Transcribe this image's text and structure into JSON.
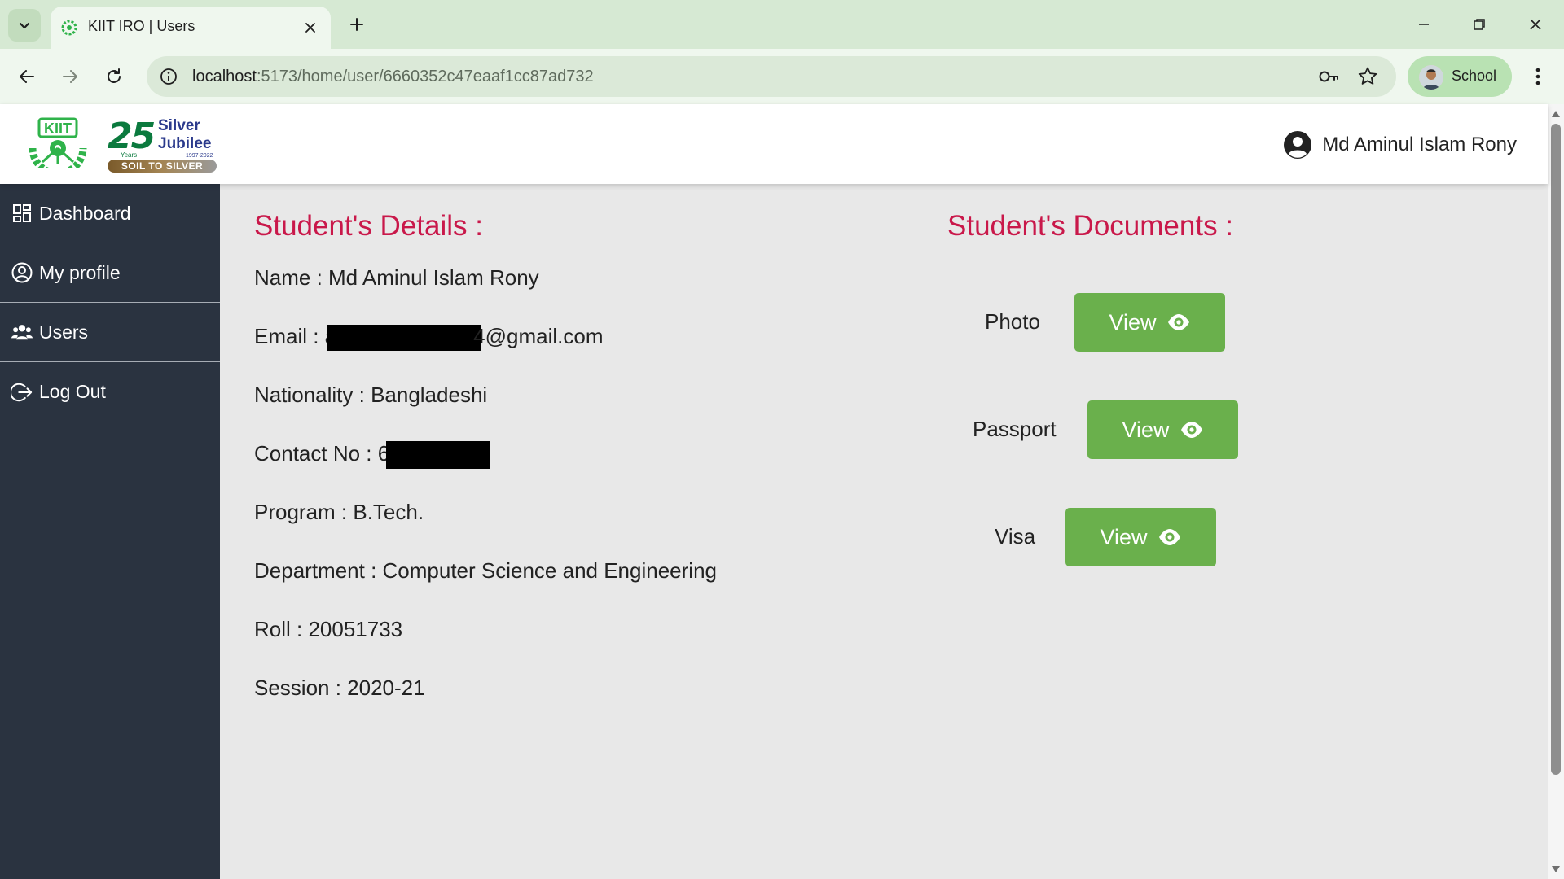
{
  "browser": {
    "tab_title": "KIIT IRO | Users",
    "url_host": "localhost",
    "url_rest": ":5173/home/user/6660352c47eaaf1cc87ad732",
    "profile_label": "School"
  },
  "header": {
    "jubilee_number": "25",
    "jubilee_years": "Years",
    "jubilee_line1": "Silver",
    "jubilee_line2": "Jubilee",
    "jubilee_range": "1997-2022",
    "jubilee_banner": "SOIL TO SILVER",
    "user_name": "Md Aminul Islam Rony"
  },
  "sidebar": {
    "items": [
      {
        "label": "Dashboard",
        "icon": "dashboard-icon"
      },
      {
        "label": "My profile",
        "icon": "user-circle-icon"
      },
      {
        "label": "Users",
        "icon": "users-icon"
      },
      {
        "label": "Log Out",
        "icon": "logout-icon"
      }
    ]
  },
  "details": {
    "title": "Student's Details :",
    "name": "Name : Md Aminul Islam Rony",
    "email_prefix": "Email : a",
    "email_suffix": "4@gmail.com",
    "nationality": "Nationality : Bangladeshi",
    "contact_prefix": "Contact No : 6",
    "program": "Program : B.Tech.",
    "department": "Department : Computer Science and Engineering",
    "roll": "Roll : 20051733",
    "session": "Session : 2020-21"
  },
  "documents": {
    "title": "Student's Documents :",
    "items": [
      {
        "label": "Photo",
        "button": "View"
      },
      {
        "label": "Passport",
        "button": "View"
      },
      {
        "label": "Visa",
        "button": "View"
      }
    ]
  },
  "colors": {
    "accent_title": "#c9184a",
    "view_button": "#6ab04c",
    "sidebar_bg": "#2a3340"
  }
}
